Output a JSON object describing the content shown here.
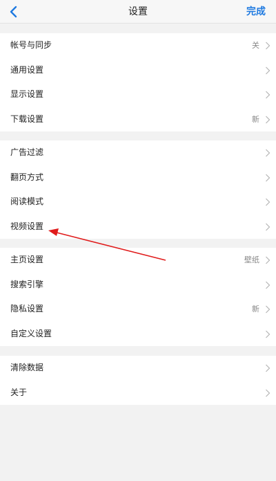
{
  "header": {
    "title": "设置",
    "done_label": "完成"
  },
  "groups": [
    {
      "items": [
        {
          "label": "帐号与同步",
          "value": "关"
        },
        {
          "label": "通用设置",
          "value": ""
        },
        {
          "label": "显示设置",
          "value": ""
        },
        {
          "label": "下载设置",
          "value": "新"
        }
      ]
    },
    {
      "items": [
        {
          "label": "广告过滤",
          "value": ""
        },
        {
          "label": "翻页方式",
          "value": ""
        },
        {
          "label": "阅读模式",
          "value": ""
        },
        {
          "label": "视频设置",
          "value": ""
        }
      ]
    },
    {
      "items": [
        {
          "label": "主页设置",
          "value": "壁纸"
        },
        {
          "label": "搜索引擎",
          "value": ""
        },
        {
          "label": "隐私设置",
          "value": "新"
        },
        {
          "label": "自定义设置",
          "value": ""
        }
      ]
    },
    {
      "items": [
        {
          "label": "清除数据",
          "value": ""
        },
        {
          "label": "关于",
          "value": ""
        }
      ]
    }
  ],
  "colors": {
    "accent": "#1f7ae0",
    "annotation_arrow": "#e01b1b",
    "background": "#f2f2f2"
  },
  "icons": {
    "back": "chevron-left-icon",
    "row": "chevron-right-icon"
  }
}
